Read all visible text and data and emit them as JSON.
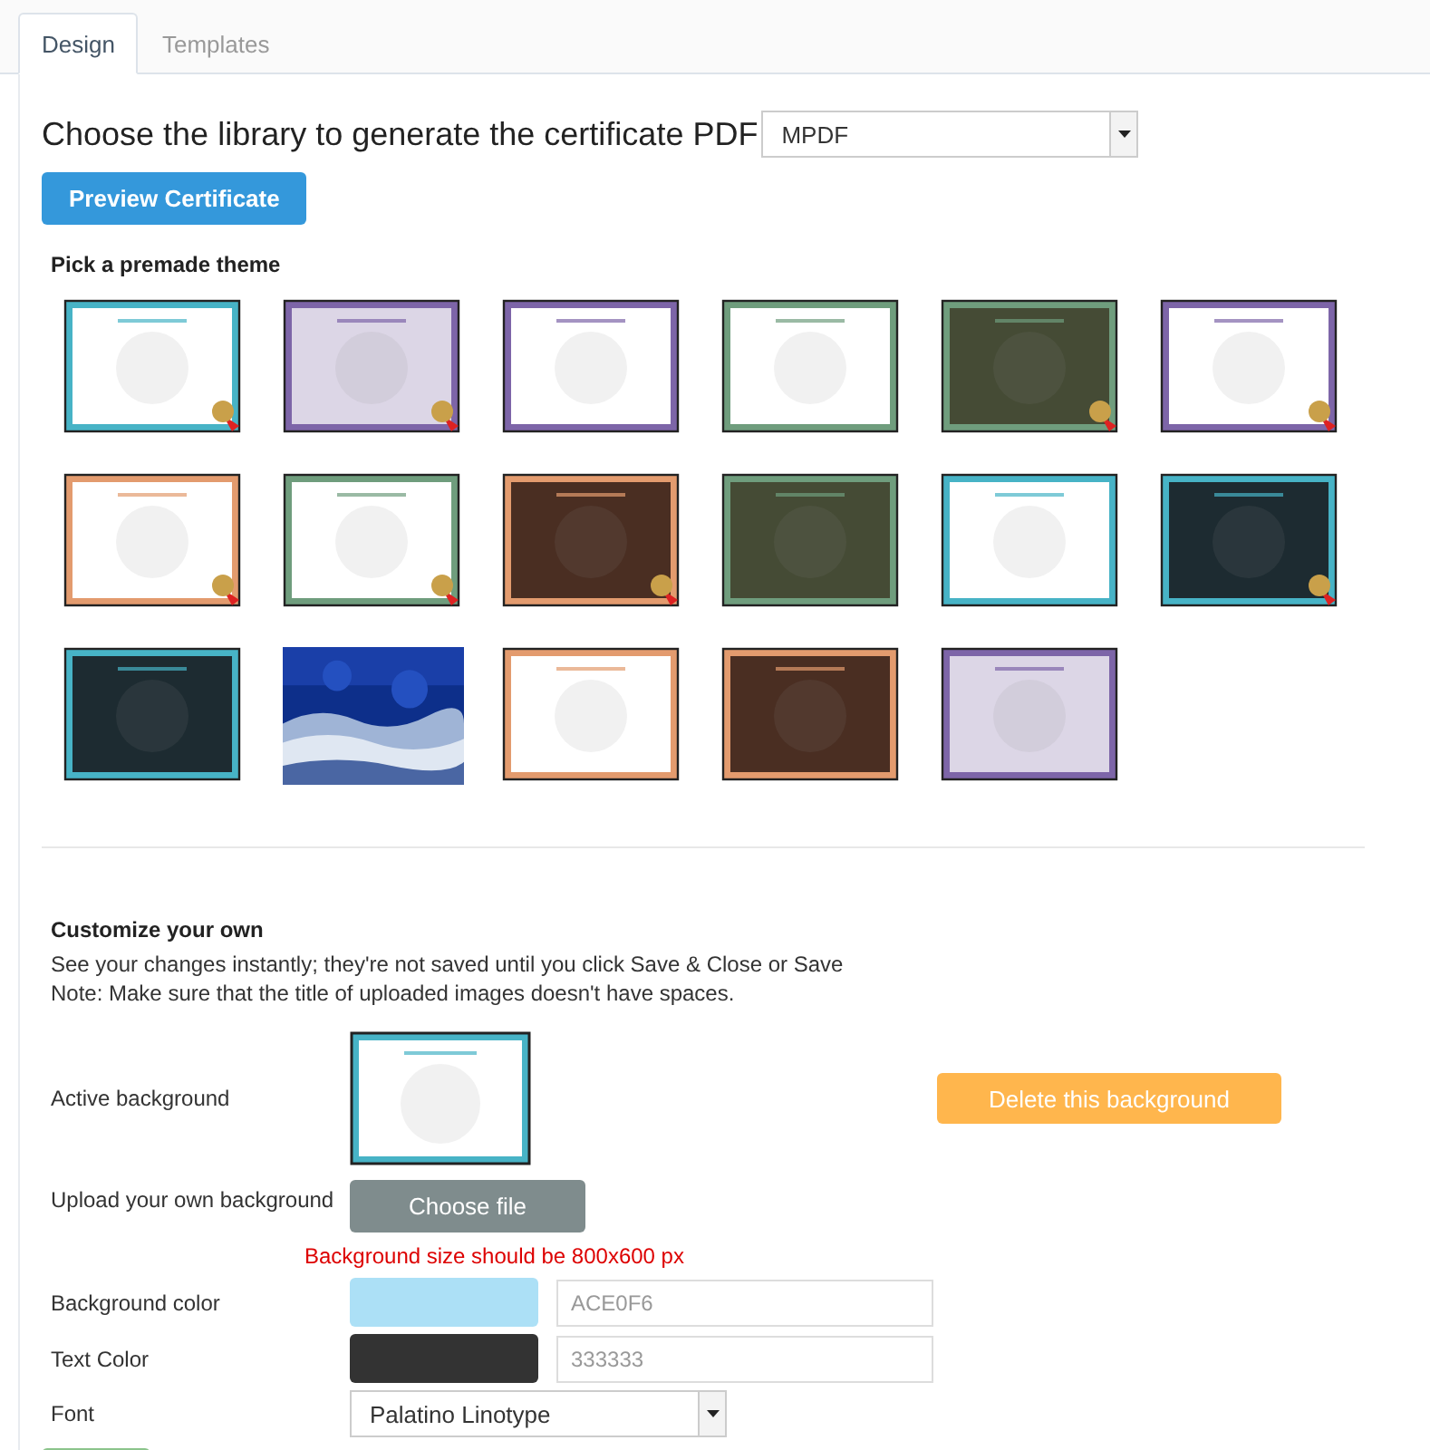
{
  "tabs": [
    {
      "label": "Design",
      "selected": true
    },
    {
      "label": "Templates",
      "selected": false
    }
  ],
  "library": {
    "label": "Choose the library to generate the certificate PDF",
    "value": "MPDF"
  },
  "preview_button": "Preview Certificate",
  "themes_heading": "Pick a premade theme",
  "themes": [
    {
      "kind": "white",
      "color": "#47b3c6",
      "seal": true
    },
    {
      "kind": "lavender",
      "color": "#7d65a8",
      "seal": true
    },
    {
      "kind": "white",
      "color": "#7d65a8",
      "seal": false
    },
    {
      "kind": "white",
      "color": "#6f9d7d",
      "seal": false
    },
    {
      "kind": "olive",
      "color": "#6f9d7d",
      "seal": true
    },
    {
      "kind": "white",
      "color": "#7d65a8",
      "seal": true
    },
    {
      "kind": "white",
      "color": "#e39b6e",
      "seal": true
    },
    {
      "kind": "white",
      "color": "#6f9d7d",
      "seal": true
    },
    {
      "kind": "brown",
      "color": "#e39b6e",
      "seal": true
    },
    {
      "kind": "olive",
      "color": "#6f9d7d",
      "seal": false
    },
    {
      "kind": "white",
      "color": "#47b3c6",
      "seal": false
    },
    {
      "kind": "slate",
      "color": "#47b3c6",
      "seal": true
    },
    {
      "kind": "slate",
      "color": "#47b3c6",
      "seal": false
    },
    {
      "kind": "picture"
    },
    {
      "kind": "white",
      "color": "#e39b6e",
      "seal": false
    },
    {
      "kind": "brown",
      "color": "#e39b6e",
      "seal": false
    },
    {
      "kind": "lavender",
      "color": "#7d65a8",
      "seal": false
    }
  ],
  "customize": {
    "heading": "Customize your own",
    "notes": [
      "See your changes instantly; they're not saved until you click Save & Close or Save",
      "Note: Make sure that the title of uploaded images doesn't have spaces."
    ],
    "active_background": {
      "label": "Active background",
      "kind": "white",
      "color": "#47b3c6",
      "seal": false
    },
    "delete_button": "Delete this background",
    "upload": {
      "label": "Upload your own background",
      "button": "Choose file",
      "hint": "Background size should be 800x600 px"
    },
    "background_color": {
      "label": "Background color",
      "color": "#ace0f6",
      "placeholder": "ACE0F6"
    },
    "text_color": {
      "label": "Text Color",
      "color": "#333333",
      "placeholder": "333333"
    },
    "font": {
      "label": "Font",
      "value": "Palatino Linotype"
    }
  }
}
